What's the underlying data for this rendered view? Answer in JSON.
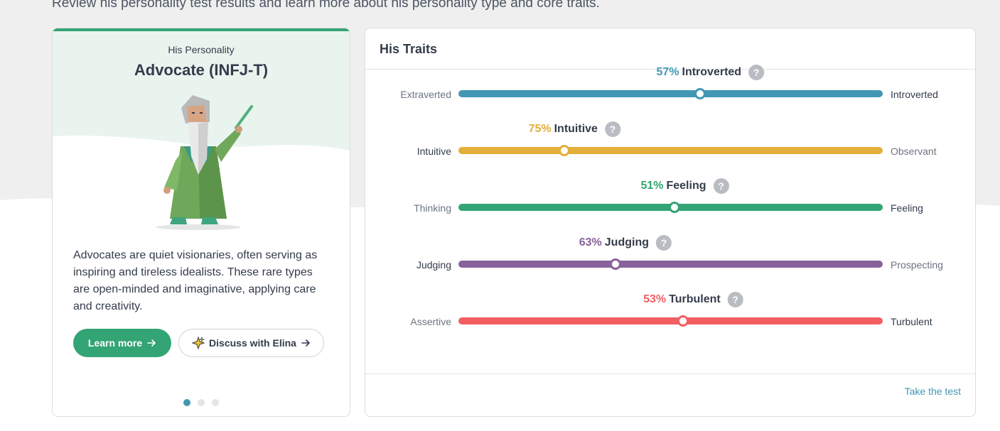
{
  "header": {
    "subtitle": "Review his personality test results and learn more about his personality type and core traits."
  },
  "personality_card": {
    "label": "His Personality",
    "type_name": "Advocate (INFJ-T)",
    "illustration_icon": "advocate-wizard-illustration",
    "description": "Advocates are quiet visionaries, often serving as inspiring and tireless idealists. These rare types are open-minded and imaginative, applying care and creativity.",
    "learn_more_label": "Learn more",
    "discuss_label": "Discuss with Elina",
    "carousel": {
      "count": 3,
      "active": 0
    },
    "accent_color": "#33a474"
  },
  "traits_card": {
    "title": "His Traits",
    "take_test_label": "Take the test",
    "traits": [
      {
        "left": "Extraverted",
        "right": "Introverted",
        "percent": "57%",
        "name": "Introverted",
        "position": 0.57,
        "dominant": "right",
        "color": "#4298b4"
      },
      {
        "left": "Intuitive",
        "right": "Observant",
        "percent": "75%",
        "name": "Intuitive",
        "position": 0.25,
        "dominant": "left",
        "color": "#e4ae3a"
      },
      {
        "left": "Thinking",
        "right": "Feeling",
        "percent": "51%",
        "name": "Feeling",
        "position": 0.51,
        "dominant": "right",
        "color": "#33a474"
      },
      {
        "left": "Judging",
        "right": "Prospecting",
        "percent": "63%",
        "name": "Judging",
        "position": 0.37,
        "dominant": "left",
        "color": "#88619a"
      },
      {
        "left": "Assertive",
        "right": "Turbulent",
        "percent": "53%",
        "name": "Turbulent",
        "position": 0.53,
        "dominant": "right",
        "color": "#f25e62"
      }
    ]
  }
}
